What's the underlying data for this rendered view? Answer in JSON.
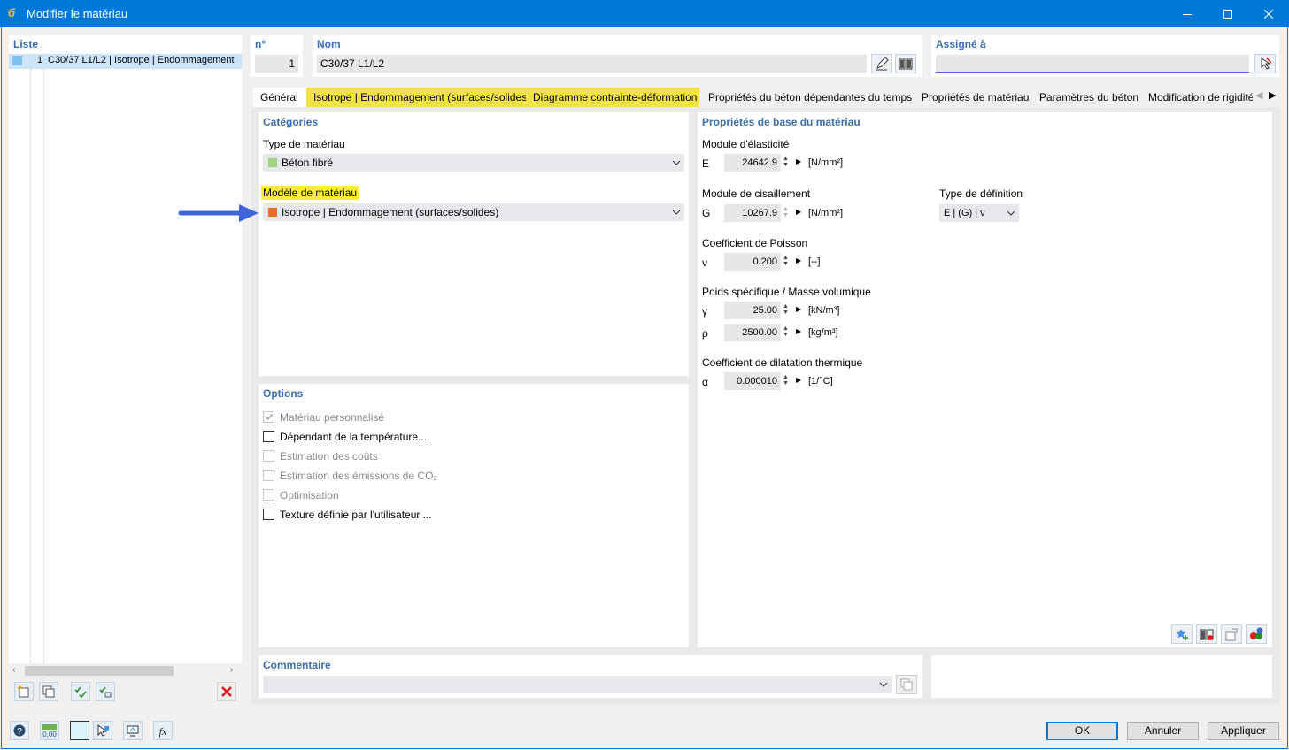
{
  "window": {
    "title": "Modifier le matériau",
    "app_icon": "rfem-icon"
  },
  "list": {
    "header": "Liste",
    "items": [
      {
        "number": "1",
        "label": "C30/37 L1/L2 | Isotrope | Endommagement",
        "color": "#7fc0ef"
      }
    ]
  },
  "no": {
    "header": "n°",
    "value": "1"
  },
  "name": {
    "header": "Nom",
    "value": "C30/37 L1/L2"
  },
  "assigned": {
    "header": "Assigné à",
    "value": ""
  },
  "tabs": [
    {
      "label": "Général",
      "state": "active"
    },
    {
      "label": "Isotrope | Endommagement (surfaces/solides)",
      "state": "highlighted"
    },
    {
      "label": "Diagramme contrainte-déformation",
      "state": "highlighted"
    },
    {
      "label": "Propriétés du béton dépendantes du temps",
      "state": "normal"
    },
    {
      "label": "Propriétés de matériau",
      "state": "normal"
    },
    {
      "label": "Paramètres du béton",
      "state": "normal"
    },
    {
      "label": "Modification de rigidité",
      "state": "normal"
    }
  ],
  "categories": {
    "title": "Catégories",
    "material_type_label": "Type de matériau",
    "material_type_value": "Béton fibré",
    "material_type_color": "#9fd47f",
    "model_label": "Modèle de matériau",
    "model_value": "Isotrope | Endommagement (surfaces/solides)",
    "model_color": "#e8702a"
  },
  "options": {
    "title": "Options",
    "items": [
      {
        "label": "Matériau personnalisé",
        "checked": true,
        "enabled": false
      },
      {
        "label": "Dépendant de la température...",
        "checked": false,
        "enabled": true
      },
      {
        "label": "Estimation des coûts",
        "checked": false,
        "enabled": false
      },
      {
        "label": "Estimation des émissions de CO₂",
        "checked": false,
        "enabled": false
      },
      {
        "label": "Optimisation",
        "checked": false,
        "enabled": false
      },
      {
        "label": "Texture définie par l'utilisateur ...",
        "checked": false,
        "enabled": true
      }
    ]
  },
  "properties": {
    "title": "Propriétés de base du matériau",
    "elastic": {
      "label": "Module d'élasticité",
      "symbol": "E",
      "value": "24642.9",
      "unit": "[N/mm²]"
    },
    "shear": {
      "label": "Module de cisaillement",
      "symbol": "G",
      "value": "10267.9",
      "unit": "[N/mm²]"
    },
    "definition": {
      "label": "Type de définition",
      "value": "E | (G) | ν"
    },
    "poisson": {
      "label": "Coefficient de Poisson",
      "symbol": "ν",
      "value": "0.200",
      "unit": "[--]"
    },
    "weight": {
      "label": "Poids spécifique / Masse volumique",
      "gamma_symbol": "γ",
      "gamma_value": "25.00",
      "gamma_unit": "[kN/m³]",
      "rho_symbol": "ρ",
      "rho_value": "2500.00",
      "rho_unit": "[kg/m³]"
    },
    "thermal": {
      "label": "Coefficient de dilatation thermique",
      "symbol": "α",
      "value": "0.000010",
      "unit": "[1/°C]"
    }
  },
  "comment": {
    "title": "Commentaire",
    "value": ""
  },
  "buttons": {
    "ok": "OK",
    "cancel": "Annuler",
    "apply": "Appliquer"
  },
  "colors": {
    "titlebar": "#0078d7",
    "section_title": "#3c6ea8",
    "highlight": "#f3e243",
    "arrow": "#3f63d9"
  }
}
